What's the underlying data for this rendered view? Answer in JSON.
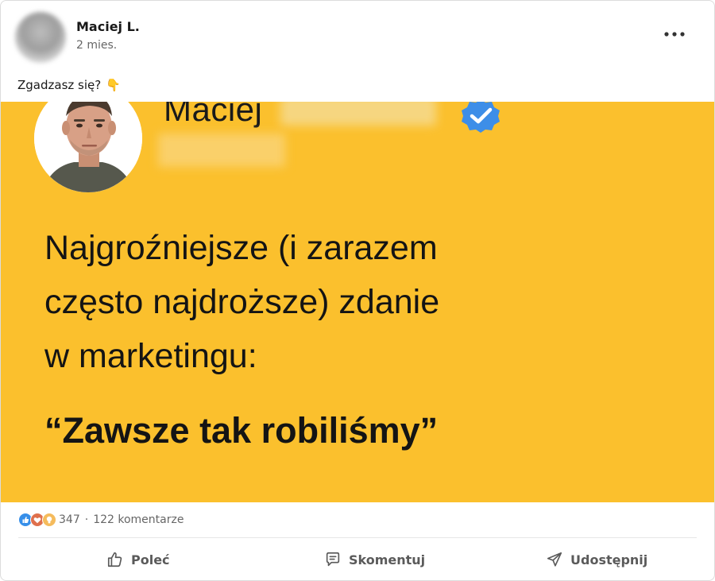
{
  "post": {
    "author": {
      "name": "Maciej L.",
      "time": "2 mies."
    },
    "menu_icon": "more-horizontal-icon",
    "text": "Zgadzasz się?",
    "text_emoji": "👇",
    "image": {
      "name": "Maciej",
      "headline_lines": [
        "Najgroźniejsze (i zarazem",
        "często najdroższe) zdanie",
        "w marketingu:"
      ],
      "quote": "“Zawsze tak robiliśmy”",
      "background_color": "#fbc02d",
      "badge_color": "#3d8ee8"
    }
  },
  "social": {
    "reactions": [
      "like",
      "love",
      "insightful"
    ],
    "reaction_count": "347",
    "separator": "·",
    "comments_label": "122 komentarze"
  },
  "actions": {
    "like_label": "Poleć",
    "comment_label": "Skomentuj",
    "share_label": "Udostępnij"
  }
}
